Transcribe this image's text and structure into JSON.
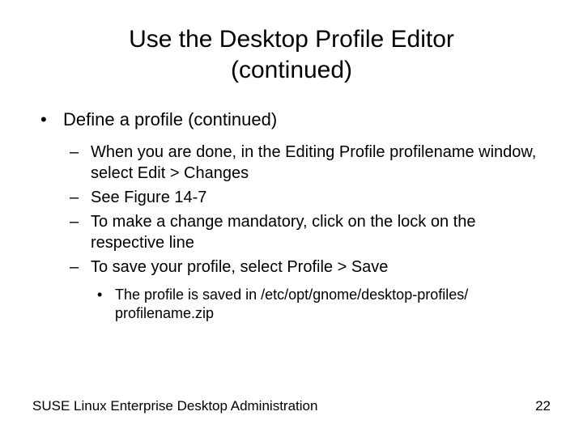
{
  "title_line1": "Use the Desktop Profile Editor",
  "title_line2": "(continued)",
  "l1": {
    "item": "Define a profile (continued)"
  },
  "l2": {
    "items": [
      "When you are done, in the Editing Profile profilename window, select Edit > Changes",
      "See Figure 14-7",
      "To make a change mandatory, click on the lock on the respective line",
      "To save your profile, select Profile > Save"
    ]
  },
  "l3": {
    "item": "The profile is saved in /etc/opt/gnome/desktop-profiles/ profilename.zip"
  },
  "footer": {
    "left": "SUSE Linux Enterprise Desktop Administration",
    "right": "22"
  },
  "markers": {
    "l1": "•",
    "l2": "–",
    "l3": "•"
  }
}
